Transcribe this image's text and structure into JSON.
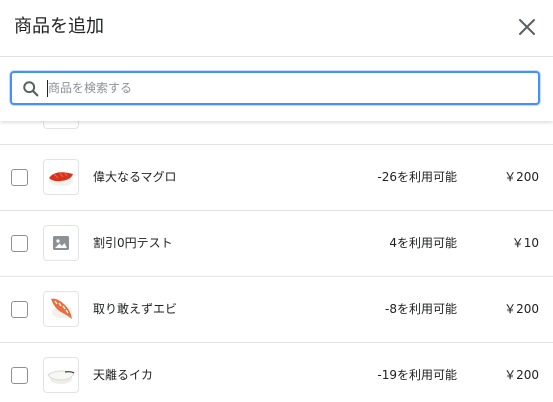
{
  "modal": {
    "title": "商品を追加"
  },
  "search": {
    "placeholder": "商品を検索する",
    "value": ""
  },
  "products": [
    {
      "name": "偉大なるマグロ",
      "availability": "-26を利用可能",
      "price": "￥200",
      "image": "tuna-sushi-icon"
    },
    {
      "name": "割引0円テスト",
      "availability": "4を利用可能",
      "price": "￥10",
      "image": "image-placeholder-icon"
    },
    {
      "name": "取り敢えずエビ",
      "availability": "-8を利用可能",
      "price": "￥200",
      "image": "shrimp-sushi-icon"
    },
    {
      "name": "天離るイカ",
      "availability": "-19を利用可能",
      "price": "￥200",
      "image": "squid-sushi-icon"
    }
  ],
  "colors": {
    "accent": "#458fff",
    "border": "#e1e3e5",
    "text": "#202223"
  }
}
